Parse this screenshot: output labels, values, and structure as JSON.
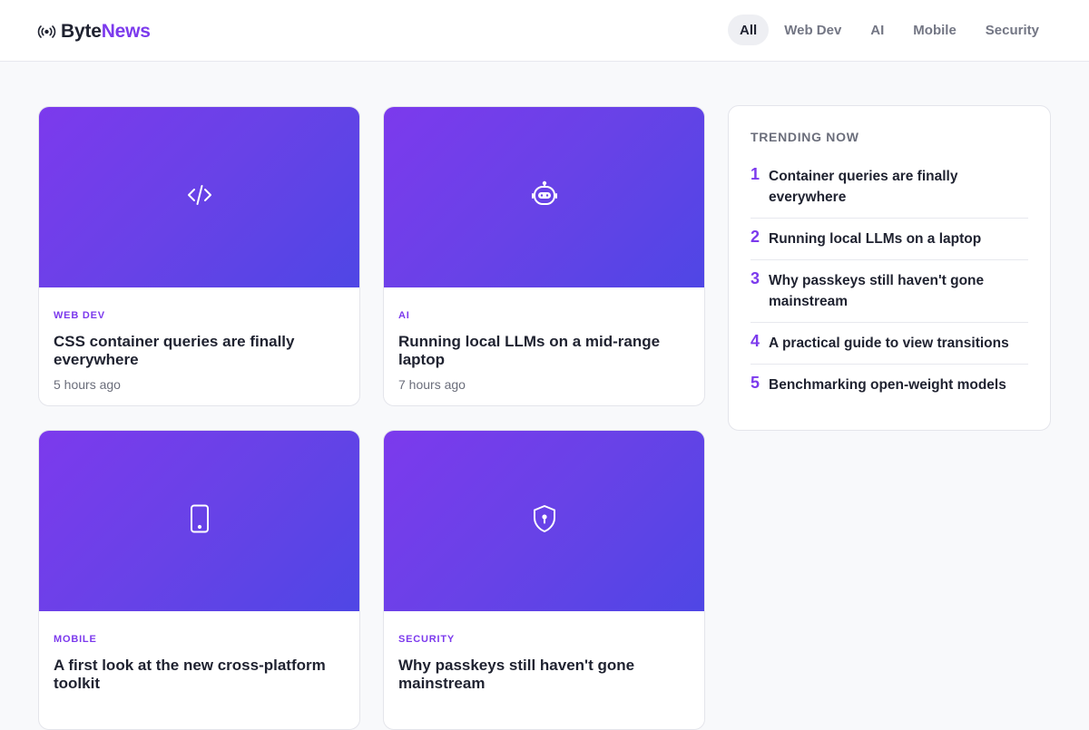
{
  "brand": {
    "name_part1": "Byte",
    "name_part2": "News",
    "accent": "#7c3aed",
    "icon": "broadcast-icon"
  },
  "nav": {
    "items": [
      {
        "label": "All",
        "active": true
      },
      {
        "label": "Web Dev",
        "active": false
      },
      {
        "label": "AI",
        "active": false
      },
      {
        "label": "Mobile",
        "active": false
      },
      {
        "label": "Security",
        "active": false
      }
    ]
  },
  "articles": [
    {
      "category": "Web Dev",
      "title": "CSS container queries are finally everywhere",
      "time": "5 hours ago",
      "icon": "code-icon"
    },
    {
      "category": "AI",
      "title": "Running local LLMs on a mid-range laptop",
      "time": "7 hours ago",
      "icon": "robot-icon"
    },
    {
      "category": "Mobile",
      "title": "A first look at the new cross-platform toolkit",
      "time": "",
      "icon": "smartphone-icon"
    },
    {
      "category": "Security",
      "title": "Why passkeys still haven't gone mainstream",
      "time": "",
      "icon": "shield-lock-icon"
    }
  ],
  "trending": {
    "heading": "Trending now",
    "items": [
      {
        "rank": "1",
        "title": "Container queries are finally everywhere"
      },
      {
        "rank": "2",
        "title": "Running local LLMs on a laptop"
      },
      {
        "rank": "3",
        "title": "Why passkeys still haven't gone mainstream"
      },
      {
        "rank": "4",
        "title": "A practical guide to view transitions"
      },
      {
        "rank": "5",
        "title": "Benchmarking open-weight models"
      }
    ]
  }
}
